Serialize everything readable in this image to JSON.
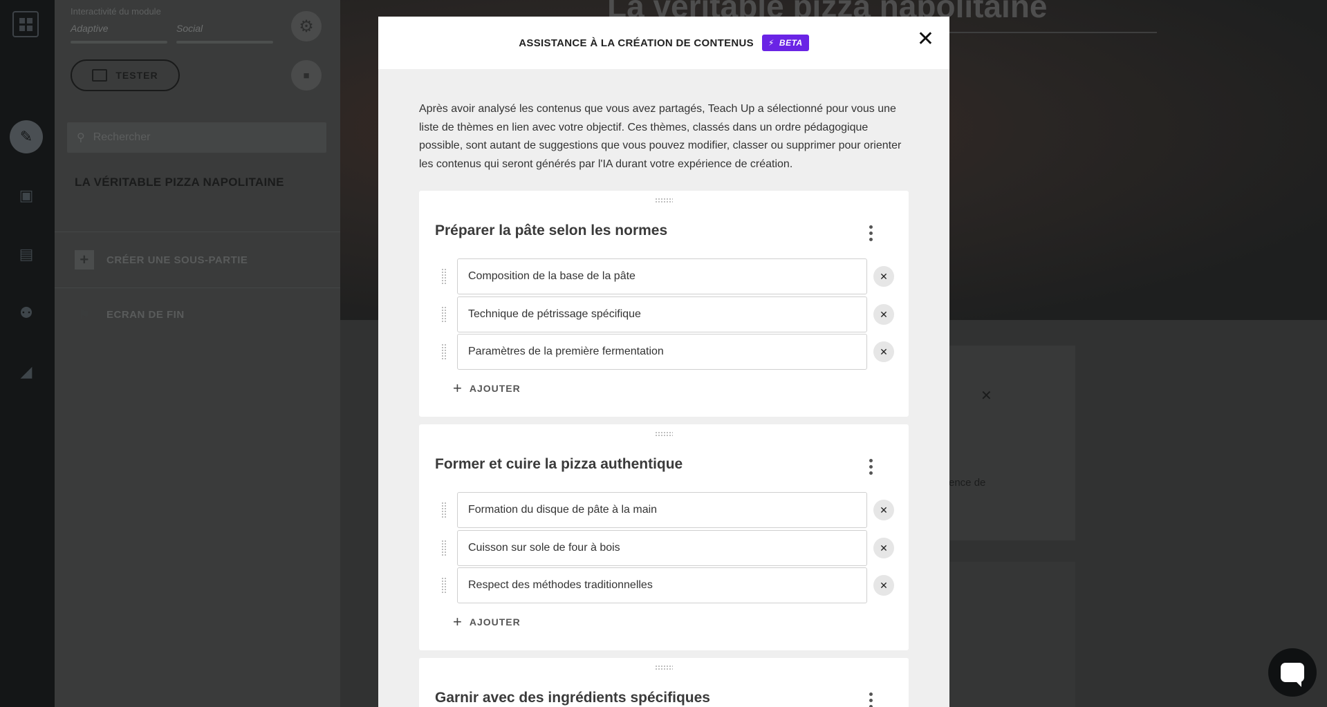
{
  "sidebar": {
    "interactivity_title": "Interactivité du module",
    "modes": [
      "Adaptive",
      "Social"
    ],
    "tester_label": "TESTER",
    "search_placeholder": "Rechercher",
    "course_title": "LA VÉRITABLE PIZZA NAPOLITAINE",
    "create_subpart": "CRÉER UNE SOUS-PARTIE",
    "end_screen": "ECRAN DE FIN"
  },
  "background": {
    "hero_title": "La véritable pizza napolitaine",
    "card_fragment": "ence de"
  },
  "modal": {
    "title": "ASSISTANCE À LA CRÉATION DE CONTENUS",
    "beta_label": "BETA",
    "intro": "Après avoir analysé les contenus que vous avez partagés, Teach Up a sélectionné pour vous une liste de thèmes en lien avec votre objectif. Ces thèmes, classés dans un ordre pédagogique possible, sont autant de suggestions que vous pouvez modifier, classer ou supprimer pour orienter les contenus qui seront générés par l'IA durant votre expérience de création.",
    "add_label": "AJOUTER",
    "themes": [
      {
        "title": "Préparer la pâte selon les normes",
        "items": [
          "Composition de la base de la pâte",
          "Technique de pétrissage spécifique",
          "Paramètres de la première fermentation"
        ]
      },
      {
        "title": "Former et cuire la pizza authentique",
        "items": [
          "Formation du disque de pâte à la main",
          "Cuisson sur sole de four à bois",
          "Respect des méthodes traditionnelles"
        ]
      },
      {
        "title": "Garnir avec des ingrédients spécifiques",
        "items": []
      }
    ]
  },
  "colors": {
    "beta_badge": "#6a24e5"
  }
}
